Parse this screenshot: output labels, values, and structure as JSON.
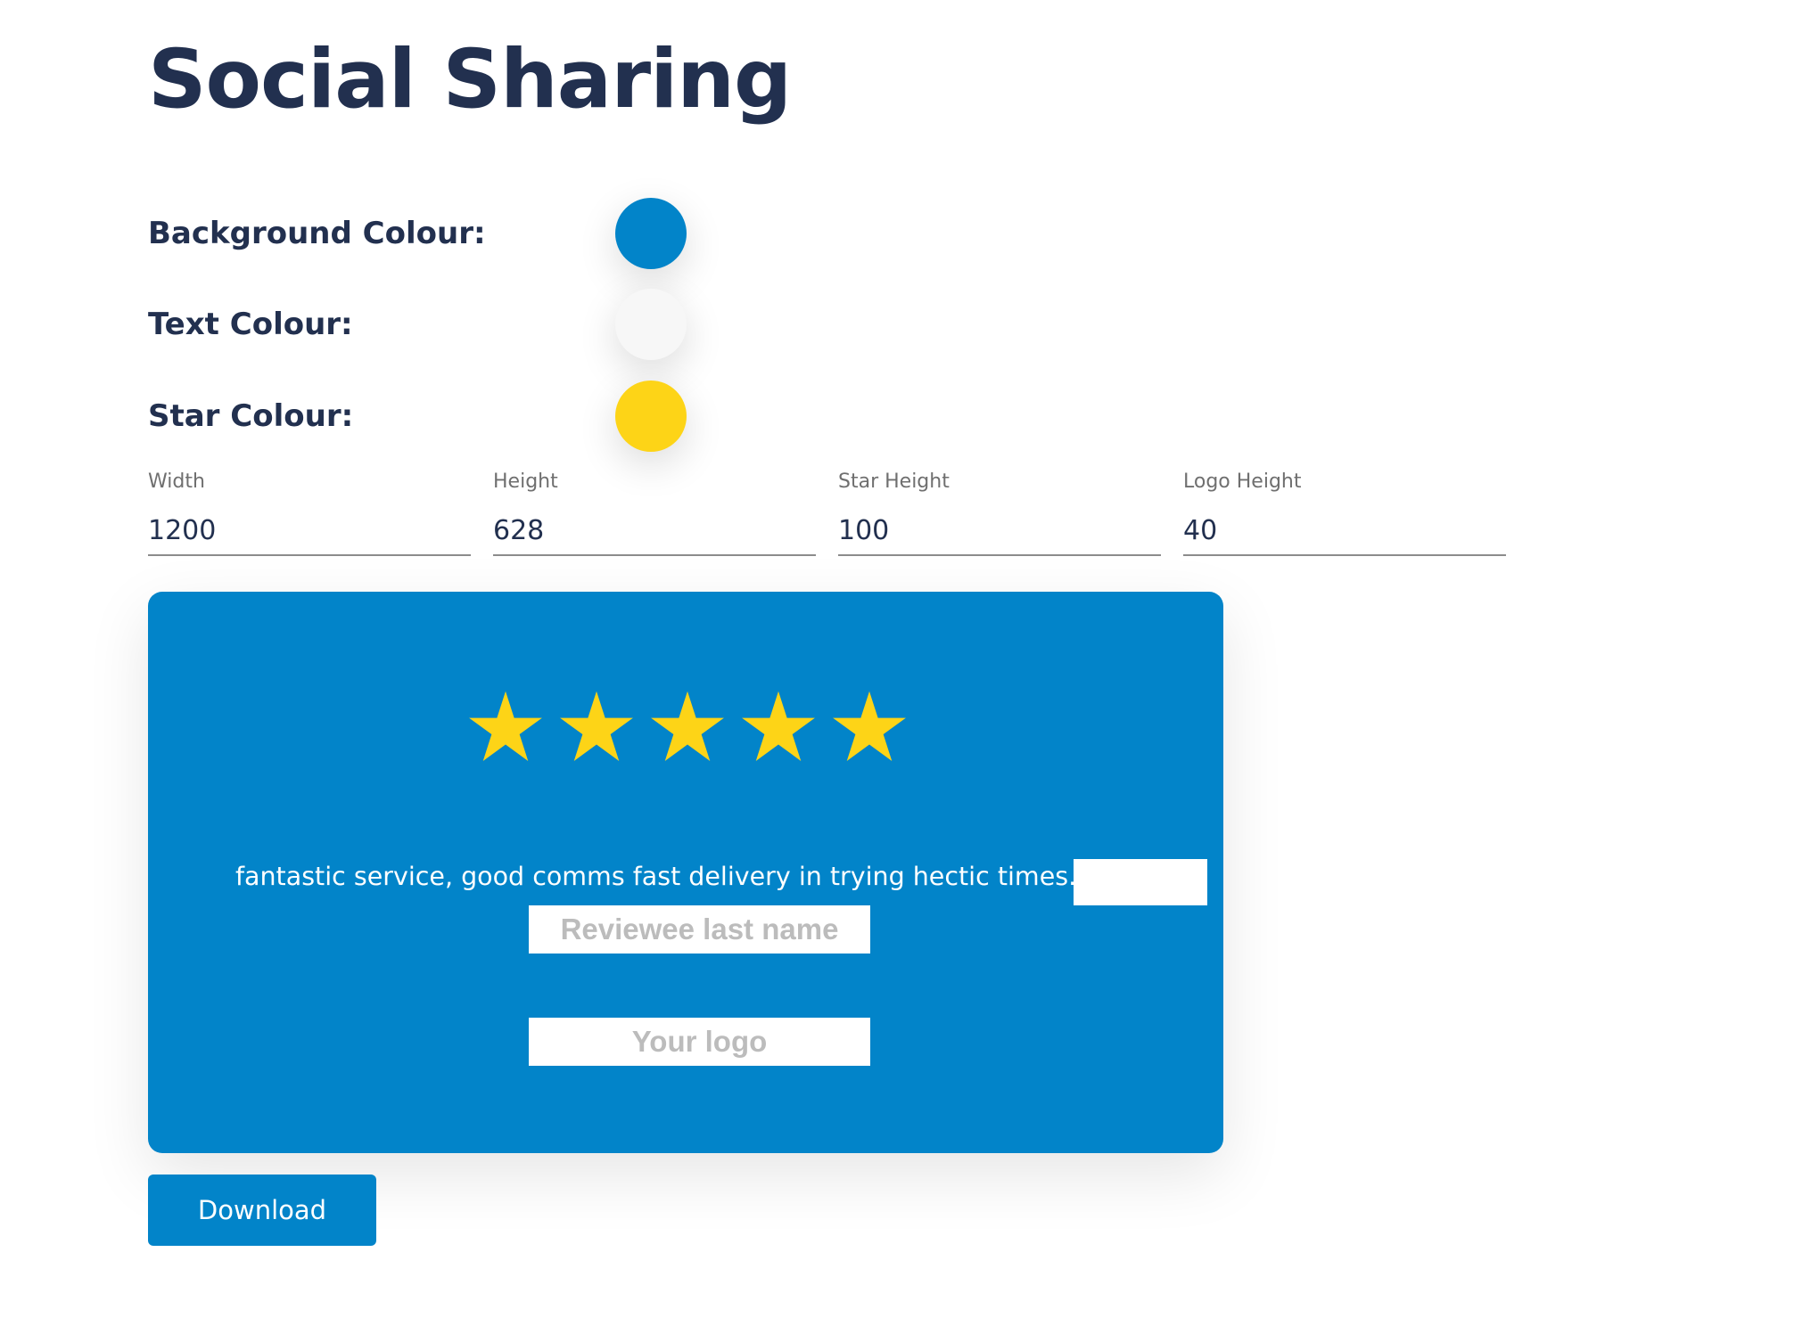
{
  "page": {
    "title": "Social Sharing"
  },
  "colours": [
    {
      "label": "Background Colour:",
      "value": "#0284c9"
    },
    {
      "label": "Text Colour:",
      "value": "#f7f7f7"
    },
    {
      "label": "Star Colour:",
      "value": "#fdd417"
    }
  ],
  "dimensions": {
    "width": {
      "label": "Width",
      "value": "1200"
    },
    "height": {
      "label": "Height",
      "value": "628"
    },
    "star_height": {
      "label": "Star Height",
      "value": "100"
    },
    "logo_height": {
      "label": "Logo Height",
      "value": "40"
    }
  },
  "preview": {
    "rating": 5,
    "max_rating": 5,
    "review_text": "fantastic service, good comms fast delivery in trying hectic times. -",
    "lastname_placeholder": "Reviewee last name",
    "logo_placeholder": "Your logo",
    "background": "#0284c9",
    "text_color": "#ffffff",
    "star_color": "#fdd417"
  },
  "actions": {
    "download_label": "Download",
    "button_color": "#0284c9"
  }
}
